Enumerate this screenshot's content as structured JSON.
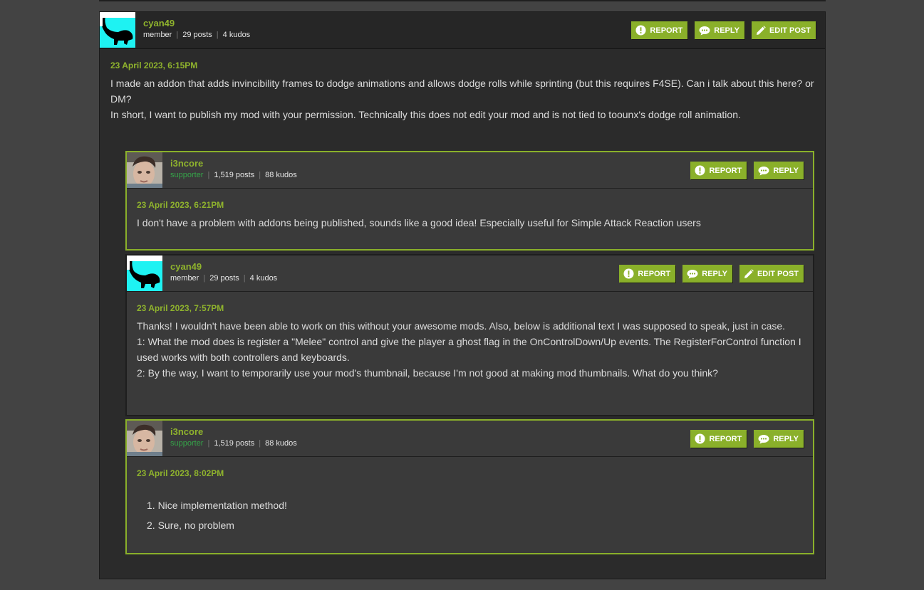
{
  "buttons": {
    "report": "REPORT",
    "reply": "REPLY",
    "edit": "EDIT POST"
  },
  "posts": [
    {
      "author": "cyan49",
      "role": "member",
      "posts": "29 posts",
      "kudos": "4 kudos",
      "date": "23 April 2023, 6:15PM",
      "paragraphs": [
        "I made an addon that adds invincibility frames to dodge animations and allows dodge rolls while sprinting (but this requires F4SE). Can i talk about this here? or DM?",
        "In short, I want to publish my mod with your permission. Technically this does not edit your mod and is not tied to toounx's dodge roll animation."
      ]
    },
    {
      "author": "i3ncore",
      "role": "supporter",
      "posts": "1,519 posts",
      "kudos": "88 kudos",
      "date": "23 April 2023, 6:21PM",
      "paragraphs": [
        "I don't have a problem with addons being published, sounds like a good idea! Especially useful for Simple Attack Reaction users"
      ]
    },
    {
      "author": "cyan49",
      "role": "member",
      "posts": "29 posts",
      "kudos": "4 kudos",
      "date": "23 April 2023, 7:57PM",
      "paragraphs": [
        "Thanks! I wouldn't have been able to work on this without your awesome mods. Also, below is additional text I was supposed to speak, just in case.",
        "1: What the mod does is register a \"Melee\" control and give the player a ghost flag in the OnControlDown/Up events. The RegisterForControl function I used works with both controllers and keyboards.",
        "2: By the way, I want to temporarily use your mod's thumbnail, because I'm not good at making mod thumbnails. What do you think?"
      ]
    },
    {
      "author": "i3ncore",
      "role": "supporter",
      "posts": "1,519 posts",
      "kudos": "88 kudos",
      "date": "23 April 2023, 8:02PM",
      "list": [
        "1. Nice implementation method!",
        "2. Sure, no problem"
      ]
    }
  ],
  "colors": {
    "accent": "#8ab02a",
    "name": "#8fb32d",
    "supporter": "#35a349",
    "cyan": "#1ef2f2"
  },
  "icons": {
    "report": "exclamation-circle-icon",
    "reply": "speech-bubble-icon",
    "edit": "pencil-icon"
  }
}
